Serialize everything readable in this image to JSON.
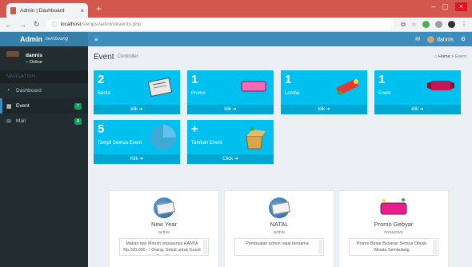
{
  "browser": {
    "tab_title": "Admin | Dashboard",
    "url_host": "localhost",
    "url_path": "/sienpsi/admin/events.php"
  },
  "logo": {
    "bold": "Admin",
    "sub": "Semboang"
  },
  "user": {
    "name": "dannis",
    "status": "Online"
  },
  "sidebar": {
    "header": "NAVIGATION",
    "items": [
      {
        "label": "Dashboard",
        "icon": "dashboard-icon",
        "badge": ""
      },
      {
        "label": "Event",
        "icon": "event-icon",
        "badge": "7"
      },
      {
        "label": "Mail",
        "icon": "mail-icon",
        "badge": "8"
      }
    ]
  },
  "topbar": {
    "user": "dannis"
  },
  "page": {
    "title": "Event",
    "subtitle": "Controller",
    "breadcrumb_home": "Home",
    "breadcrumb_current": "Event"
  },
  "boxes": [
    {
      "num": "2",
      "label": "Berita",
      "footer": "klik",
      "art": "newspaper"
    },
    {
      "num": "1",
      "label": "Promo",
      "footer": "klik",
      "art": "promo"
    },
    {
      "num": "1",
      "label": "Lomba",
      "footer": "klik",
      "art": "contest"
    },
    {
      "num": "1",
      "label": "Event",
      "footer": "klik",
      "art": "event"
    },
    {
      "num": "5",
      "label": "Tampil Semua Event",
      "footer": "Klik",
      "art": "pie"
    },
    {
      "num": "+",
      "label": "Tambah Event",
      "footer": "Click",
      "art": "box"
    }
  ],
  "cards": [
    {
      "title": "New Year",
      "status": "active",
      "desc": "Makan dan Minum sepuasnya HANYA Rp.100.000,- / Orang. Sebat untuk Guest atau Non-Guest"
    },
    {
      "title": "NATAL",
      "status": "active",
      "desc": "Pembuatan pohon natal bersama"
    },
    {
      "title": "Promo Gebyar",
      "status": "nonactive",
      "desc": "Promo Besar Besaran Semua Obyek Wisata Sembulang"
    }
  ],
  "colors": {
    "aqua": "#00c0ef",
    "header": "#3c8dbc",
    "sidebar": "#222d32"
  }
}
